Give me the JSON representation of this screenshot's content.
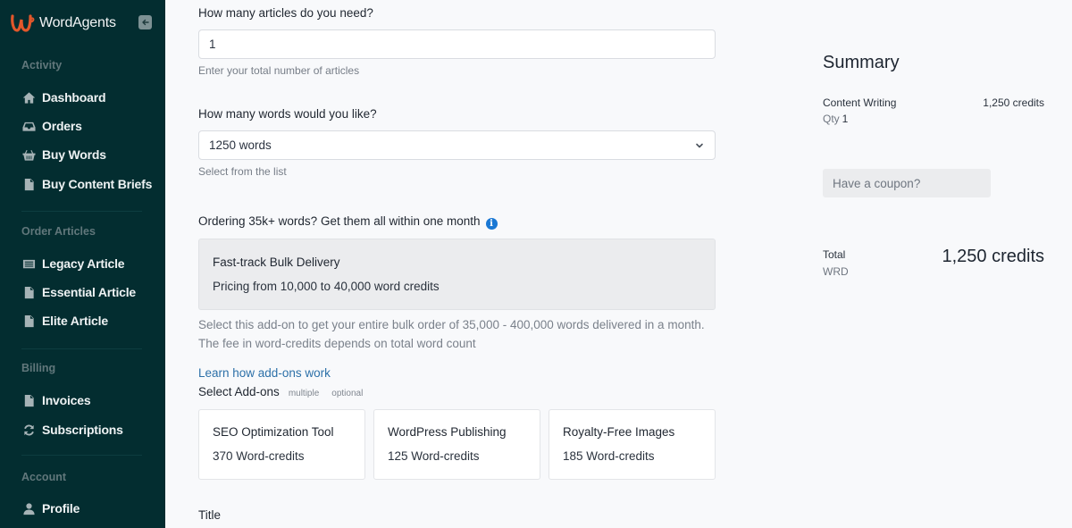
{
  "app": {
    "brand_name": "WordAgents",
    "brand_color": "#e2572b",
    "sidebar_bg": "#032d30",
    "collapse_icon": "arrow-left-icon"
  },
  "sidebar": {
    "sections": [
      {
        "label": "Activity",
        "items": [
          {
            "label": "Dashboard",
            "icon": "home-icon"
          },
          {
            "label": "Orders",
            "icon": "inbox-icon"
          },
          {
            "label": "Buy Words",
            "icon": "basket-icon"
          },
          {
            "label": "Buy Content Briefs",
            "icon": "document-icon"
          }
        ]
      },
      {
        "label": "Order Articles",
        "items": [
          {
            "label": "Legacy Article",
            "icon": "list-card-icon"
          },
          {
            "label": "Essential Article",
            "icon": "document-icon"
          },
          {
            "label": "Elite Article",
            "icon": "document-icon"
          }
        ]
      },
      {
        "label": "Billing",
        "items": [
          {
            "label": "Invoices",
            "icon": "document-icon"
          },
          {
            "label": "Subscriptions",
            "icon": "refresh-icon"
          }
        ]
      },
      {
        "label": "Account",
        "items": [
          {
            "label": "Profile",
            "icon": "user-icon"
          }
        ]
      }
    ]
  },
  "form": {
    "articles": {
      "label": "How many articles do you need?",
      "value": "1",
      "help": "Enter your total number of articles"
    },
    "words": {
      "label": "How many words would you like?",
      "selected": "1250 words",
      "help": "Select from the list"
    },
    "bulk": {
      "heading": "Ordering 35k+ words? Get them all within one month",
      "title": "Fast-track Bulk Delivery",
      "pricing": "Pricing from 10,000 to 40,000 word credits",
      "description": "Select this add-on to get your entire bulk order of 35,000 - 400,000 words delivered in a month. The fee in word-credits depends on total word count"
    },
    "addons": {
      "link": "Learn how add-ons work",
      "label": "Select Add-ons",
      "tags": [
        "multiple",
        "optional"
      ],
      "items": [
        {
          "title": "SEO Optimization Tool",
          "price": "370 Word-credits"
        },
        {
          "title": "WordPress Publishing",
          "price": "125 Word-credits"
        },
        {
          "title": "Royalty-Free Images",
          "price": "185 Word-credits"
        }
      ]
    },
    "title_label": "Title"
  },
  "summary": {
    "title": "Summary",
    "item_name": "Content Writing",
    "item_value": "1,250 credits",
    "qty_label": "Qty",
    "qty_value": "1",
    "coupon_placeholder": "Have a coupon?",
    "total_label": "Total",
    "currency": "WRD",
    "total_value": "1,250 credits"
  }
}
